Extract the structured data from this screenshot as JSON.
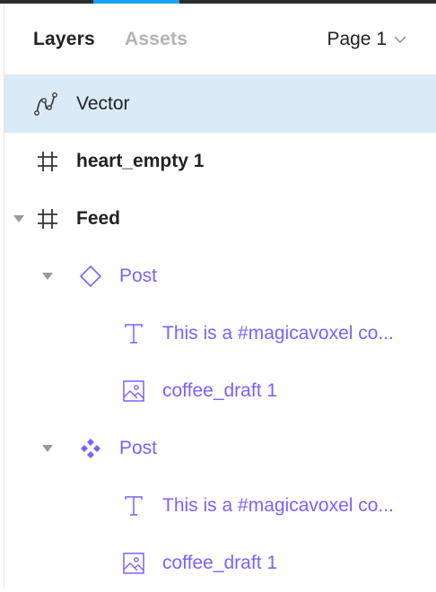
{
  "header": {
    "tabs": [
      {
        "label": "Layers",
        "active": true
      },
      {
        "label": "Assets",
        "active": false
      }
    ],
    "page_selector": {
      "label": "Page 1",
      "icon": "chevron-down-icon"
    }
  },
  "layers": [
    {
      "name": "Vector",
      "type": "vector",
      "icon": "vector-icon",
      "selected": true,
      "depth": 0,
      "expanded": null
    },
    {
      "name": "heart_empty 1",
      "type": "frame",
      "icon": "frame-icon",
      "selected": false,
      "depth": 0,
      "expanded": null
    },
    {
      "name": "Feed",
      "type": "frame",
      "icon": "frame-icon",
      "selected": false,
      "depth": 0,
      "expanded": true
    },
    {
      "name": "Post",
      "type": "instance",
      "icon": "instance-icon",
      "selected": false,
      "depth": 1,
      "expanded": true
    },
    {
      "name": "This is a #magicavoxel co...",
      "type": "text",
      "icon": "text-icon",
      "selected": false,
      "depth": 2,
      "expanded": null
    },
    {
      "name": "coffee_draft 1",
      "type": "image",
      "icon": "image-icon",
      "selected": false,
      "depth": 2,
      "expanded": null
    },
    {
      "name": "Post",
      "type": "component",
      "icon": "component-icon",
      "selected": false,
      "depth": 1,
      "expanded": true
    },
    {
      "name": "This is a #magicavoxel co...",
      "type": "text",
      "icon": "text-icon",
      "selected": false,
      "depth": 2,
      "expanded": null
    },
    {
      "name": "coffee_draft 1",
      "type": "image",
      "icon": "image-icon",
      "selected": false,
      "depth": 2,
      "expanded": null
    }
  ],
  "colors": {
    "selection": "#daebf7",
    "component": "#7b61ff",
    "accent": "#18a0fb",
    "text": "#222222",
    "muted": "#b3b3b3"
  }
}
